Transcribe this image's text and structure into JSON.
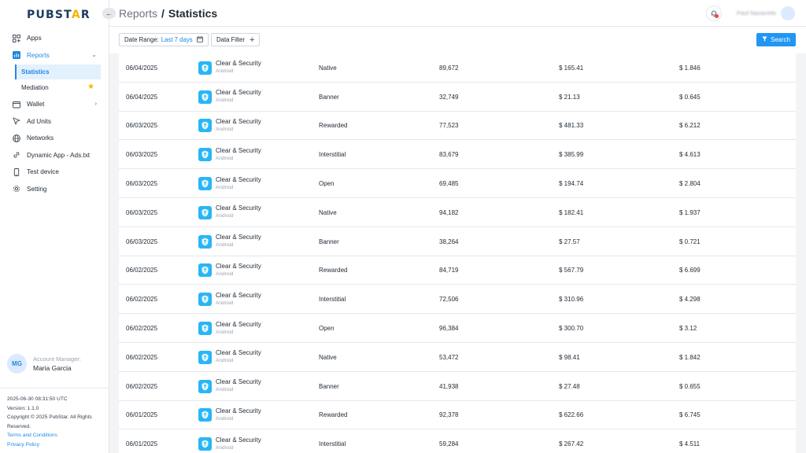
{
  "logo": {
    "part1": "PUBST",
    "part2": "A",
    "part3": "R"
  },
  "sidebar": {
    "items": [
      {
        "label": "Apps",
        "icon": "apps-icon"
      },
      {
        "label": "Reports",
        "icon": "reports-icon"
      },
      {
        "label": "Wallet",
        "icon": "wallet-icon"
      },
      {
        "label": "Ad Units",
        "icon": "cursor-icon"
      },
      {
        "label": "Networks",
        "icon": "globe-icon"
      },
      {
        "label": "Dynamic App - Ads.txt",
        "icon": "link-icon"
      },
      {
        "label": "Test device",
        "icon": "phone-icon"
      },
      {
        "label": "Setting",
        "icon": "gear-icon"
      }
    ],
    "sub_items": [
      {
        "label": "Statistics"
      },
      {
        "label": "Mediation"
      }
    ],
    "manager": {
      "initials": "MG",
      "label": "Account Manager:",
      "name": "Maria Garcia"
    },
    "footer": {
      "timestamp": "2025-06-30 08:31:50 UTC",
      "version": "Version: 1.1.0",
      "copyright": "Copyright © 2025 PubStar. All Rights Reserved.",
      "terms": "Terms and Conditions",
      "privacy": "Privacy Policy"
    }
  },
  "header": {
    "breadcrumb_parent": "Reports",
    "breadcrumb_sep": "/",
    "breadcrumb_current": "Statistics",
    "user_name": "Paul Navarrete"
  },
  "toolbar": {
    "date_label": "Date Range:",
    "date_value": "Last 7 days",
    "data_filter_label": "Data Filter",
    "search_label": "Search"
  },
  "table": {
    "rows": [
      {
        "date": "06/04/2025",
        "app": "Clear & Security",
        "platform": "Android",
        "format": "Native",
        "requests": "89,672",
        "revenue": "$ 165.41",
        "ecpm": "$ 1.846"
      },
      {
        "date": "06/04/2025",
        "app": "Clear & Security",
        "platform": "Android",
        "format": "Banner",
        "requests": "32,749",
        "revenue": "$ 21.13",
        "ecpm": "$ 0.645"
      },
      {
        "date": "06/03/2025",
        "app": "Clear & Security",
        "platform": "Android",
        "format": "Rewarded",
        "requests": "77,523",
        "revenue": "$ 481.33",
        "ecpm": "$ 6.212"
      },
      {
        "date": "06/03/2025",
        "app": "Clear & Security",
        "platform": "Android",
        "format": "Interstitial",
        "requests": "83,679",
        "revenue": "$ 385.99",
        "ecpm": "$ 4.613"
      },
      {
        "date": "06/03/2025",
        "app": "Clear & Security",
        "platform": "Android",
        "format": "Open",
        "requests": "69,485",
        "revenue": "$ 194.74",
        "ecpm": "$ 2.804"
      },
      {
        "date": "06/03/2025",
        "app": "Clear & Security",
        "platform": "Android",
        "format": "Native",
        "requests": "94,182",
        "revenue": "$ 182.41",
        "ecpm": "$ 1.937"
      },
      {
        "date": "06/03/2025",
        "app": "Clear & Security",
        "platform": "Android",
        "format": "Banner",
        "requests": "38,264",
        "revenue": "$ 27.57",
        "ecpm": "$ 0.721"
      },
      {
        "date": "06/02/2025",
        "app": "Clear & Security",
        "platform": "Android",
        "format": "Rewarded",
        "requests": "84,719",
        "revenue": "$ 567.79",
        "ecpm": "$ 6.699"
      },
      {
        "date": "06/02/2025",
        "app": "Clear & Security",
        "platform": "Android",
        "format": "Interstitial",
        "requests": "72,506",
        "revenue": "$ 310.96",
        "ecpm": "$ 4.298"
      },
      {
        "date": "06/02/2025",
        "app": "Clear & Security",
        "platform": "Android",
        "format": "Open",
        "requests": "96,384",
        "revenue": "$ 300.70",
        "ecpm": "$ 3.12"
      },
      {
        "date": "06/02/2025",
        "app": "Clear & Security",
        "platform": "Android",
        "format": "Native",
        "requests": "53,472",
        "revenue": "$ 98.41",
        "ecpm": "$ 1.842"
      },
      {
        "date": "06/02/2025",
        "app": "Clear & Security",
        "platform": "Android",
        "format": "Banner",
        "requests": "41,938",
        "revenue": "$ 27.48",
        "ecpm": "$ 0.655"
      },
      {
        "date": "06/01/2025",
        "app": "Clear & Security",
        "platform": "Android",
        "format": "Rewarded",
        "requests": "92,378",
        "revenue": "$ 622.66",
        "ecpm": "$ 6.745"
      },
      {
        "date": "06/01/2025",
        "app": "Clear & Security",
        "platform": "Android",
        "format": "Interstitial",
        "requests": "59,284",
        "revenue": "$ 267.42",
        "ecpm": "$ 4.511"
      }
    ]
  }
}
